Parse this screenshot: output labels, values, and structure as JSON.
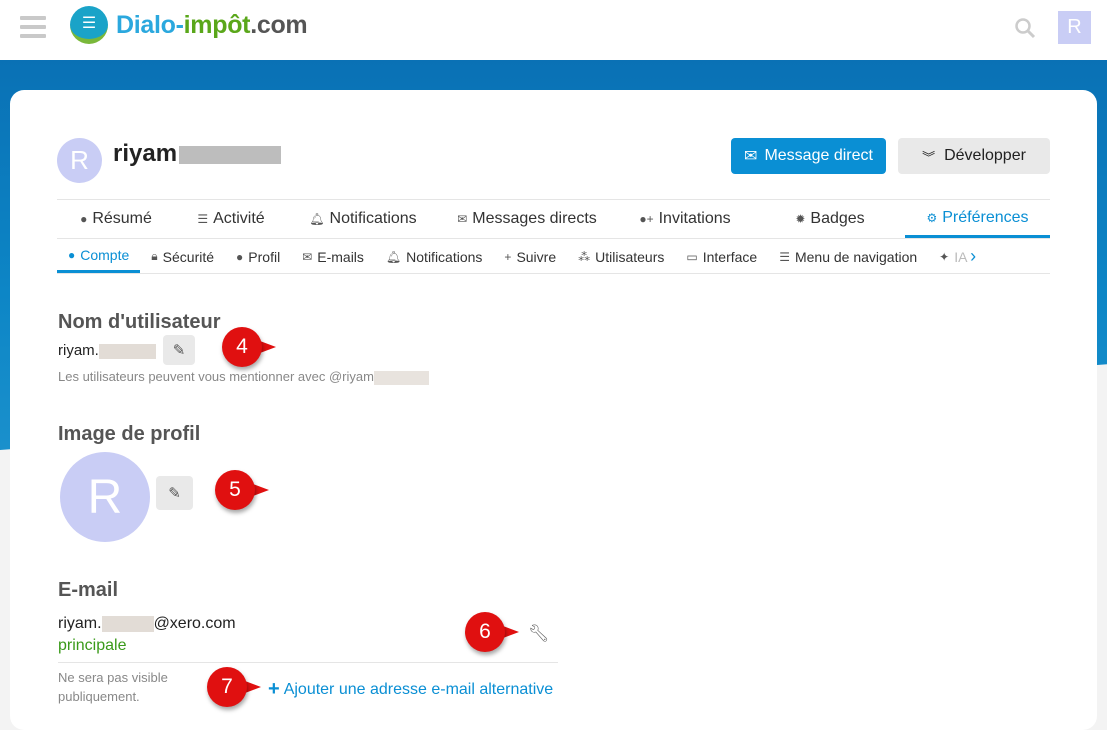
{
  "header": {
    "logo_part1": "Dialo-",
    "logo_part2": "impôt",
    "logo_part3": ".com",
    "avatar_letter": "R"
  },
  "profile": {
    "avatar_letter": "R",
    "username": "riyam",
    "message_button": "Message direct",
    "expand_button": "Développer"
  },
  "main_tabs": [
    {
      "label": "Résumé",
      "icon": "user-icon"
    },
    {
      "label": "Activité",
      "icon": "list-icon"
    },
    {
      "label": "Notifications",
      "icon": "bell-icon"
    },
    {
      "label": "Messages directs",
      "icon": "envelope-icon"
    },
    {
      "label": "Invitations",
      "icon": "user-plus-icon"
    },
    {
      "label": "Badges",
      "icon": "badge-icon"
    },
    {
      "label": "Préférences",
      "icon": "gear-icon",
      "active": true
    }
  ],
  "sub_tabs": [
    {
      "label": "Compte",
      "active": true
    },
    {
      "label": "Sécurité"
    },
    {
      "label": "Profil"
    },
    {
      "label": "E-mails"
    },
    {
      "label": "Notifications"
    },
    {
      "label": "Suivre"
    },
    {
      "label": "Utilisateurs"
    },
    {
      "label": "Interface"
    },
    {
      "label": "Menu de navigation"
    },
    {
      "label": "IA"
    }
  ],
  "username_section": {
    "title": "Nom d'utilisateur",
    "value": "riyam.",
    "hint": "Les utilisateurs peuvent vous mentionner avec @riyam"
  },
  "avatar_section": {
    "title": "Image de profil",
    "letter": "R"
  },
  "email_section": {
    "title": "E-mail",
    "address_prefix": "riyam.",
    "address_suffix": "@xero.com",
    "primary_label": "principale",
    "privacy_note": "Ne sera pas visible publiquement.",
    "add_alt": "Ajouter une adresse e-mail alternative"
  },
  "markers": [
    "4",
    "5",
    "6",
    "7"
  ],
  "colors": {
    "accent": "#0a8fd4",
    "primary_green": "#3a9a1a",
    "marker": "#e01010"
  }
}
